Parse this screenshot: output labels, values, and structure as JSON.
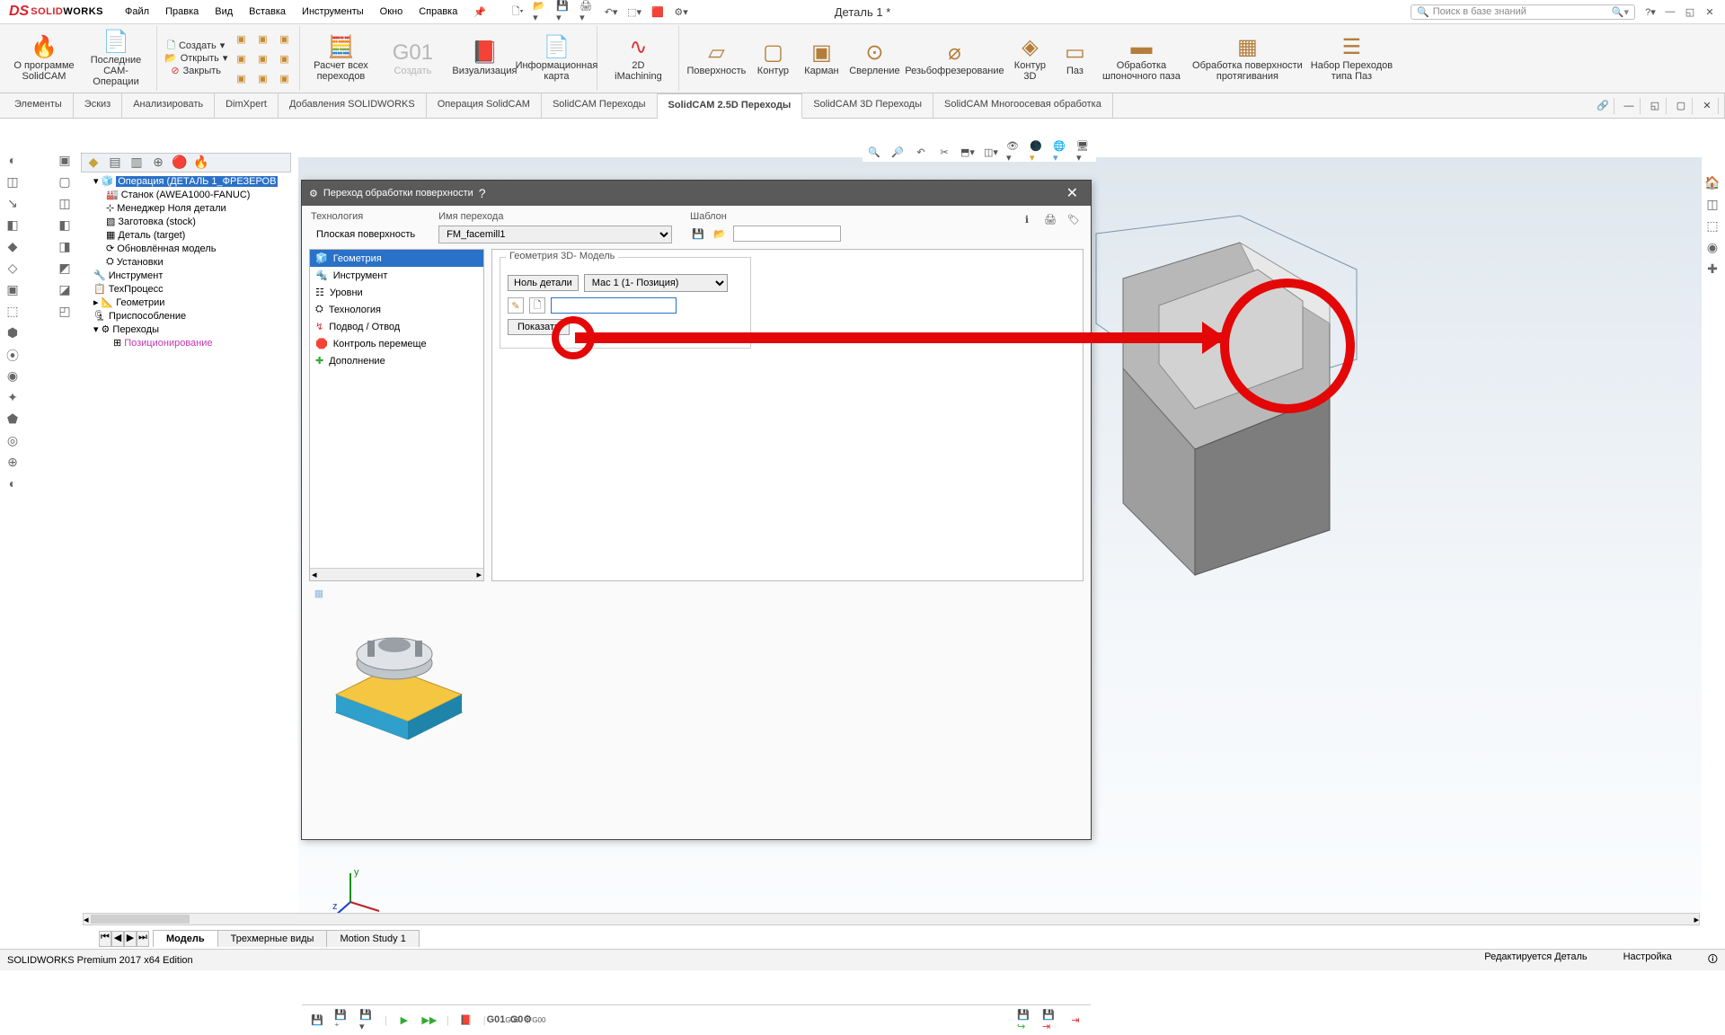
{
  "logo": {
    "brand1": "SOLID",
    "brand2": "WORKS"
  },
  "menu": [
    "Файл",
    "Правка",
    "Вид",
    "Вставка",
    "Инструменты",
    "Окно",
    "Справка"
  ],
  "doc_title": "Деталь 1 *",
  "search_placeholder": "Поиск в базе знаний",
  "ribbon": {
    "about": "О программе\nSolidCAM",
    "recent": "Последние\nСАМ-Операции",
    "create": "Создать",
    "open": "Открыть",
    "close": "Закрыть",
    "calc": "Расчет всех\nпереходов",
    "make": "Создать",
    "viz": "Визуализация",
    "info": "Информационная\nкарта",
    "im": "2D\niMachining",
    "surf": "Поверхность",
    "contour": "Контур",
    "pocket": "Карман",
    "drill": "Сверление",
    "thread": "Резьбофрезерование",
    "k3d": "Контур\n3D",
    "slot": "Паз",
    "key": "Обработка\nшпоночного паза",
    "psurf": "Обработка поверхности\nпротягивания",
    "ptrans": "Набор Переходов\nтипа Паз"
  },
  "ribbon_tabs": [
    "Элементы",
    "Эскиз",
    "Анализировать",
    "DimXpert",
    "Добавления SOLIDWORKS",
    "Операция  SolidCAM",
    "SolidCAM Переходы",
    "SolidCAM 2.5D Переходы",
    "SolidCAM 3D Переходы",
    "SolidCAM Многоосевая обработка"
  ],
  "active_ribbon_tab": 7,
  "tree": {
    "root": "Операция (ДЕТАЛЬ 1_ФРЕЗЕРОВ",
    "machine": "Станок (AWEA1000-FANUC)",
    "partzero": "Менеджер Ноля детали",
    "stock": "Заготовка (stock)",
    "target": "Деталь (target)",
    "updated": "Обновлённая модель",
    "setups": "Установки",
    "tool": "Инструмент",
    "process": "ТехПроцесс",
    "geom": "Геометрии",
    "fixture": "Приспособление",
    "ops": "Переходы",
    "pos": "Позиционирование"
  },
  "dialog": {
    "title": "Переход обработки поверхности",
    "tech_label": "Технология",
    "tech_value": "Плоская поверхность",
    "name_label": "Имя перехода",
    "name_value": "FM_facemill1",
    "template_label": "Шаблон",
    "nav": [
      "Геометрия",
      "Инструмент",
      "Уровни",
      "Технология",
      "Подвод / Отвод",
      "Контроль перемеще",
      "Дополнение"
    ],
    "nav_selected": 0,
    "group3d": "Геометрия 3D- Модель",
    "partzero_btn": "Ноль детали",
    "mac_select": "Mac 1 (1- Позиция)",
    "show_btn": "Показать"
  },
  "bottom_tabs": [
    "Модель",
    "Трехмерные виды",
    "Motion Study 1"
  ],
  "status_left": "SOLIDWORKS Premium 2017 x64 Edition",
  "status_right1": "Редактируется Деталь",
  "status_right2": "Настройка"
}
